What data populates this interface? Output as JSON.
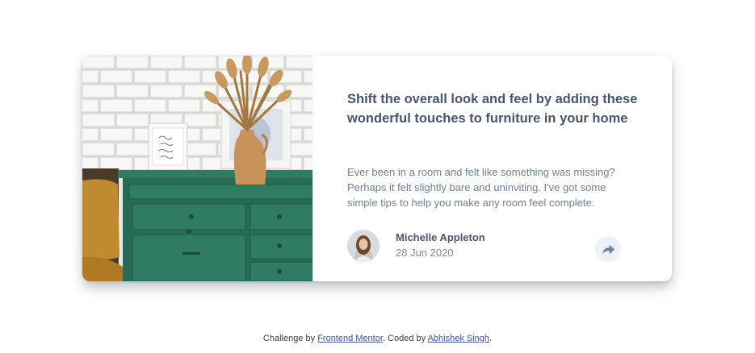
{
  "article": {
    "title": "Shift the overall look and feel by adding these wonderful touches to furniture in your home",
    "description": "Ever been in a room and felt like something was missing? Perhaps it felt slightly bare and uninviting. I've got some simple tips to help you make any room feel complete.",
    "author_name": "Michelle Appleton",
    "date": "28 Jun 2020",
    "share_icon": "share-arrow-icon"
  },
  "footer": {
    "prefix": "Challenge by ",
    "link1": "Frontend Mentor",
    "middle": ". Coded by ",
    "link2": "Abhishek Singh",
    "suffix": "."
  },
  "colors": {
    "title": "#48556a",
    "text": "#6e8098",
    "share_bg": "#ecf2f8",
    "link": "#3e52a3",
    "drawer": "#2f7c63"
  }
}
